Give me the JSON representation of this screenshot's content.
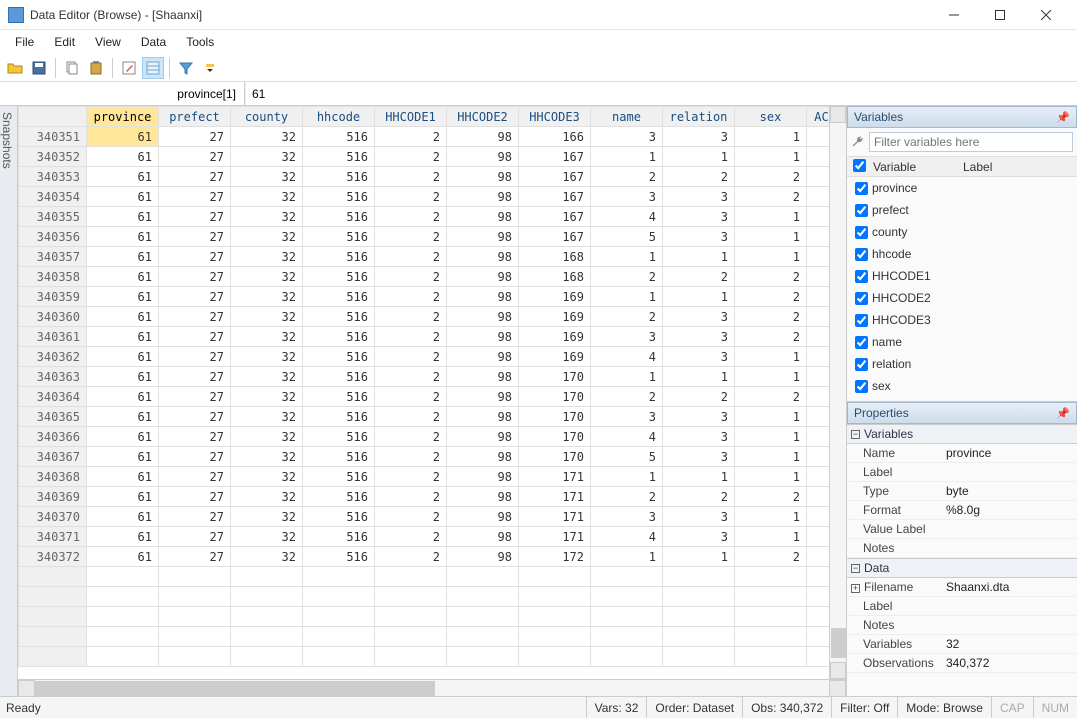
{
  "window": {
    "title": "Data Editor (Browse) - [Shaanxi]"
  },
  "menu": {
    "file": "File",
    "edit": "Edit",
    "view": "View",
    "data": "Data",
    "tools": "Tools"
  },
  "cellbar": {
    "name": "province[1]",
    "value": "61"
  },
  "snapshots_label": "Snapshots",
  "columns": [
    "province",
    "prefect",
    "county",
    "hhcode",
    "HHCODE1",
    "HHCODE2",
    "HHCODE3",
    "name",
    "relation",
    "sex",
    "AC"
  ],
  "rows": [
    {
      "id": "340351",
      "v": [
        "61",
        "27",
        "32",
        "516",
        "2",
        "98",
        "166",
        "3",
        "3",
        "1",
        ""
      ]
    },
    {
      "id": "340352",
      "v": [
        "61",
        "27",
        "32",
        "516",
        "2",
        "98",
        "167",
        "1",
        "1",
        "1",
        ""
      ]
    },
    {
      "id": "340353",
      "v": [
        "61",
        "27",
        "32",
        "516",
        "2",
        "98",
        "167",
        "2",
        "2",
        "2",
        ""
      ]
    },
    {
      "id": "340354",
      "v": [
        "61",
        "27",
        "32",
        "516",
        "2",
        "98",
        "167",
        "3",
        "3",
        "2",
        ""
      ]
    },
    {
      "id": "340355",
      "v": [
        "61",
        "27",
        "32",
        "516",
        "2",
        "98",
        "167",
        "4",
        "3",
        "1",
        ""
      ]
    },
    {
      "id": "340356",
      "v": [
        "61",
        "27",
        "32",
        "516",
        "2",
        "98",
        "167",
        "5",
        "3",
        "1",
        ""
      ]
    },
    {
      "id": "340357",
      "v": [
        "61",
        "27",
        "32",
        "516",
        "2",
        "98",
        "168",
        "1",
        "1",
        "1",
        ""
      ]
    },
    {
      "id": "340358",
      "v": [
        "61",
        "27",
        "32",
        "516",
        "2",
        "98",
        "168",
        "2",
        "2",
        "2",
        ""
      ]
    },
    {
      "id": "340359",
      "v": [
        "61",
        "27",
        "32",
        "516",
        "2",
        "98",
        "169",
        "1",
        "1",
        "2",
        ""
      ]
    },
    {
      "id": "340360",
      "v": [
        "61",
        "27",
        "32",
        "516",
        "2",
        "98",
        "169",
        "2",
        "3",
        "2",
        ""
      ]
    },
    {
      "id": "340361",
      "v": [
        "61",
        "27",
        "32",
        "516",
        "2",
        "98",
        "169",
        "3",
        "3",
        "2",
        ""
      ]
    },
    {
      "id": "340362",
      "v": [
        "61",
        "27",
        "32",
        "516",
        "2",
        "98",
        "169",
        "4",
        "3",
        "1",
        ""
      ]
    },
    {
      "id": "340363",
      "v": [
        "61",
        "27",
        "32",
        "516",
        "2",
        "98",
        "170",
        "1",
        "1",
        "1",
        ""
      ]
    },
    {
      "id": "340364",
      "v": [
        "61",
        "27",
        "32",
        "516",
        "2",
        "98",
        "170",
        "2",
        "2",
        "2",
        ""
      ]
    },
    {
      "id": "340365",
      "v": [
        "61",
        "27",
        "32",
        "516",
        "2",
        "98",
        "170",
        "3",
        "3",
        "1",
        ""
      ]
    },
    {
      "id": "340366",
      "v": [
        "61",
        "27",
        "32",
        "516",
        "2",
        "98",
        "170",
        "4",
        "3",
        "1",
        ""
      ]
    },
    {
      "id": "340367",
      "v": [
        "61",
        "27",
        "32",
        "516",
        "2",
        "98",
        "170",
        "5",
        "3",
        "1",
        ""
      ]
    },
    {
      "id": "340368",
      "v": [
        "61",
        "27",
        "32",
        "516",
        "2",
        "98",
        "171",
        "1",
        "1",
        "1",
        ""
      ]
    },
    {
      "id": "340369",
      "v": [
        "61",
        "27",
        "32",
        "516",
        "2",
        "98",
        "171",
        "2",
        "2",
        "2",
        ""
      ]
    },
    {
      "id": "340370",
      "v": [
        "61",
        "27",
        "32",
        "516",
        "2",
        "98",
        "171",
        "3",
        "3",
        "1",
        ""
      ]
    },
    {
      "id": "340371",
      "v": [
        "61",
        "27",
        "32",
        "516",
        "2",
        "98",
        "171",
        "4",
        "3",
        "1",
        ""
      ]
    },
    {
      "id": "340372",
      "v": [
        "61",
        "27",
        "32",
        "516",
        "2",
        "98",
        "172",
        "1",
        "1",
        "2",
        ""
      ]
    }
  ],
  "variables_panel": {
    "title": "Variables",
    "filter_placeholder": "Filter variables here",
    "header_chk": "✔",
    "header_var": "Variable",
    "header_label": "Label",
    "items": [
      "province",
      "prefect",
      "county",
      "hhcode",
      "HHCODE1",
      "HHCODE2",
      "HHCODE3",
      "name",
      "relation",
      "sex"
    ]
  },
  "properties_panel": {
    "title": "Properties",
    "sections": {
      "variables": "Variables",
      "data": "Data"
    },
    "var_props": {
      "Name": "province",
      "Label": "",
      "Type": "byte",
      "Format": "%8.0g",
      "Value Label": "",
      "Notes": ""
    },
    "data_props": {
      "Filename": "Shaanxi.dta",
      "Label": "",
      "Notes": "",
      "Variables": "32",
      "Observations": "340,372"
    }
  },
  "statusbar": {
    "ready": "Ready",
    "vars": "Vars: 32",
    "order": "Order: Dataset",
    "obs": "Obs: 340,372",
    "filter": "Filter: Off",
    "mode": "Mode: Browse",
    "cap": "CAP",
    "num": "NUM"
  }
}
